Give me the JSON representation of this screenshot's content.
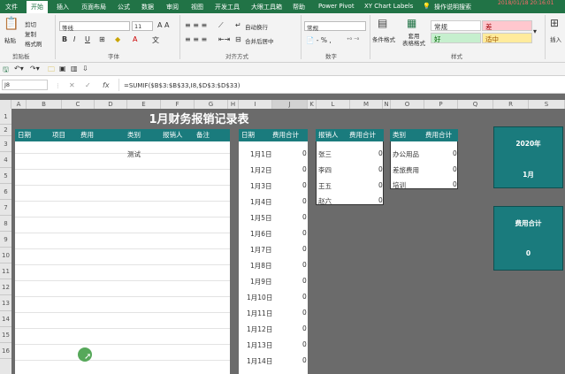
{
  "ribbon_tabs": [
    "文件",
    "开始",
    "插入",
    "页面布局",
    "公式",
    "数据",
    "审阅",
    "视图",
    "开发工具",
    "大眼工具箱",
    "帮助",
    "Power Pivot",
    "XY Chart Labels",
    "操作说明搜索"
  ],
  "timestamp": "2018/01/18 20:16:01",
  "clipboard": {
    "cut": "剪切",
    "copy": "复制",
    "painter": "格式刷",
    "paste": "粘贴",
    "group": "剪贴板"
  },
  "font": {
    "name": "等线",
    "size": "11",
    "group": "字体"
  },
  "alignment": {
    "wrap": "自动换行",
    "merge": "合并后居中",
    "group": "对齐方式"
  },
  "number": {
    "format": "常规",
    "group": "数字"
  },
  "styles": {
    "cond": "条件格式",
    "table": "套用\n表格格式",
    "normal": "常规",
    "bad": "差",
    "good": "好",
    "neutral": "适中",
    "group": "样式"
  },
  "insert_label": "插入",
  "name_box": "J8",
  "formula": "=SUMIF($B$3:$B$33,I8,$D$3:$D$33)",
  "col_letters": [
    "A",
    "B",
    "C",
    "D",
    "E",
    "F",
    "G",
    "H",
    "I",
    "J",
    "K",
    "L",
    "M",
    "N",
    "O",
    "P",
    "Q",
    "R",
    "S"
  ],
  "row_numbers": [
    "1",
    "2",
    "3",
    "4",
    "5",
    "6",
    "7",
    "8",
    "9",
    "10",
    "11",
    "12",
    "13",
    "14",
    "15",
    "16"
  ],
  "main_title": "1月财务报销记录表",
  "headers_main": [
    "日期",
    "项目",
    "费用",
    "类别",
    "报销人",
    "备注"
  ],
  "main_note": "测试",
  "headers_date": [
    "日期",
    "费用合计"
  ],
  "dates": [
    "1月1日",
    "1月2日",
    "1月3日",
    "1月4日",
    "1月5日",
    "1月6日",
    "1月7日",
    "1月8日",
    "1月9日",
    "1月10日",
    "1月11日",
    "1月12日",
    "1月13日",
    "1月14日"
  ],
  "date_values": [
    "0",
    "0",
    "0",
    "0",
    "0",
    "0",
    "0",
    "0",
    "0",
    "0",
    "0",
    "0",
    "0",
    "0"
  ],
  "headers_person": [
    "报销人",
    "费用合计"
  ],
  "persons": [
    "张三",
    "李四",
    "王五",
    "赵六"
  ],
  "person_values": [
    "0",
    "0",
    "0",
    "0"
  ],
  "headers_cat": [
    "类别",
    "费用合计"
  ],
  "categories": [
    "办公用品",
    "差旅费用",
    "培训"
  ],
  "cat_values": [
    "0",
    "0",
    "0"
  ],
  "card_year": {
    "line1": "2020年",
    "line2": "1月"
  },
  "card_total": {
    "line1": "费用合计",
    "line2": "0"
  },
  "colors": {
    "accent": "#1a7b7d",
    "ribbon": "#217346"
  }
}
